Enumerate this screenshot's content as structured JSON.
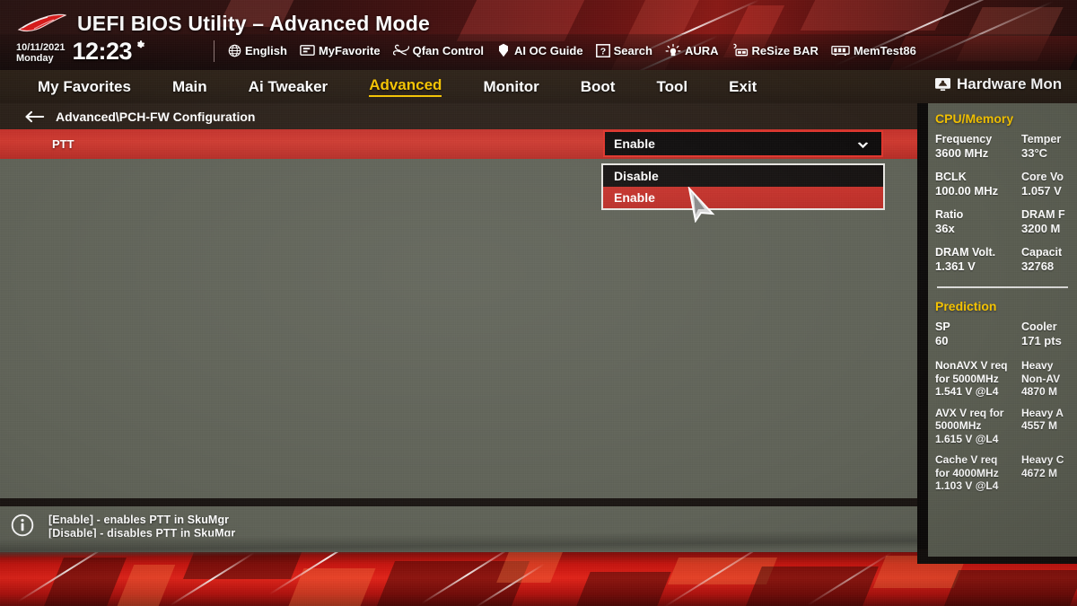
{
  "header": {
    "title": "UEFI BIOS Utility – Advanced Mode",
    "logo": "rog-logo",
    "date": "10/11/2021",
    "weekday": "Monday",
    "time": "12:23",
    "gear_icon": "gear-icon",
    "tools": [
      {
        "icon": "globe-icon",
        "label": "English"
      },
      {
        "icon": "bookmark-icon",
        "label": "MyFavorite"
      },
      {
        "icon": "fan-icon",
        "label": "Qfan Control"
      },
      {
        "icon": "ai-icon",
        "label": "AI OC Guide"
      },
      {
        "icon": "search-icon",
        "label": "Search"
      },
      {
        "icon": "aura-icon",
        "label": "AURA"
      },
      {
        "icon": "resize-icon",
        "label": "ReSize BAR"
      },
      {
        "icon": "memtest-icon",
        "label": "MemTest86"
      }
    ]
  },
  "nav": {
    "items": [
      {
        "label": "My Favorites",
        "active": false
      },
      {
        "label": "Main",
        "active": false
      },
      {
        "label": "Ai Tweaker",
        "active": false
      },
      {
        "label": "Advanced",
        "active": true
      },
      {
        "label": "Monitor",
        "active": false
      },
      {
        "label": "Boot",
        "active": false
      },
      {
        "label": "Tool",
        "active": false
      },
      {
        "label": "Exit",
        "active": false
      }
    ],
    "hardware_monitor_label": "Hardware Mon"
  },
  "main": {
    "breadcrumb": "Advanced\\PCH-FW Configuration",
    "back_icon": "back-arrow-icon",
    "setting": {
      "label": "PTT",
      "value": "Enable",
      "caret_icon": "chevron-down-icon"
    },
    "dropdown": {
      "options": [
        {
          "label": "Disable",
          "selected": false
        },
        {
          "label": "Enable",
          "selected": true
        }
      ]
    },
    "cursor_icon": "mouse-cursor-icon"
  },
  "help": {
    "icon": "info-icon",
    "lines": [
      "[Enable] - enables PTT in SkuMgr",
      "[Disable] - disables PTT in SkuMgr"
    ]
  },
  "sidebar": {
    "monitor_icon": "monitor-icon",
    "cpu_memory": {
      "title": "CPU/Memory",
      "entries": [
        {
          "key": "Frequency",
          "value": "3600 MHz",
          "key2": "Temper",
          "value2": "33°C"
        },
        {
          "key": "BCLK",
          "value": "100.00 MHz",
          "key2": "Core Vo",
          "value2": "1.057 V"
        },
        {
          "key": "Ratio",
          "value": "36x",
          "key2": "DRAM F",
          "value2": "3200 M"
        },
        {
          "key": "DRAM Volt.",
          "value": "1.361 V",
          "key2": "Capacit",
          "value2": "32768 "
        }
      ]
    },
    "prediction": {
      "title": "Prediction",
      "entries": [
        {
          "key": "SP",
          "value": "60",
          "key2": "Cooler",
          "value2": "171 pts"
        }
      ],
      "rows": [
        {
          "left": [
            "NonAVX V req",
            "for 5000MHz",
            "1.541 V @L4"
          ],
          "left_hl": [
            false,
            true,
            false
          ],
          "right": [
            "Heavy",
            "Non-AV",
            "4870 M"
          ]
        },
        {
          "left": [
            "AVX V req    for",
            "5000MHz",
            "1.615 V @L4"
          ],
          "left_hl": [
            false,
            true,
            false
          ],
          "right": [
            "Heavy A",
            "4557 M",
            ""
          ]
        },
        {
          "left": [
            "Cache V req",
            "for 4000MHz",
            "1.103 V @L4"
          ],
          "left_hl": [
            false,
            true,
            false
          ],
          "right": [
            "Heavy C",
            "4672 M",
            ""
          ]
        }
      ]
    }
  },
  "colors": {
    "accent_red": "#cf3a30",
    "accent_yellow": "#f6c400",
    "highlight_yellow": "#f6e96b",
    "panel_bg": "#5f6257",
    "header_bg": "#2a1614",
    "nav_bg": "#2d2218"
  }
}
